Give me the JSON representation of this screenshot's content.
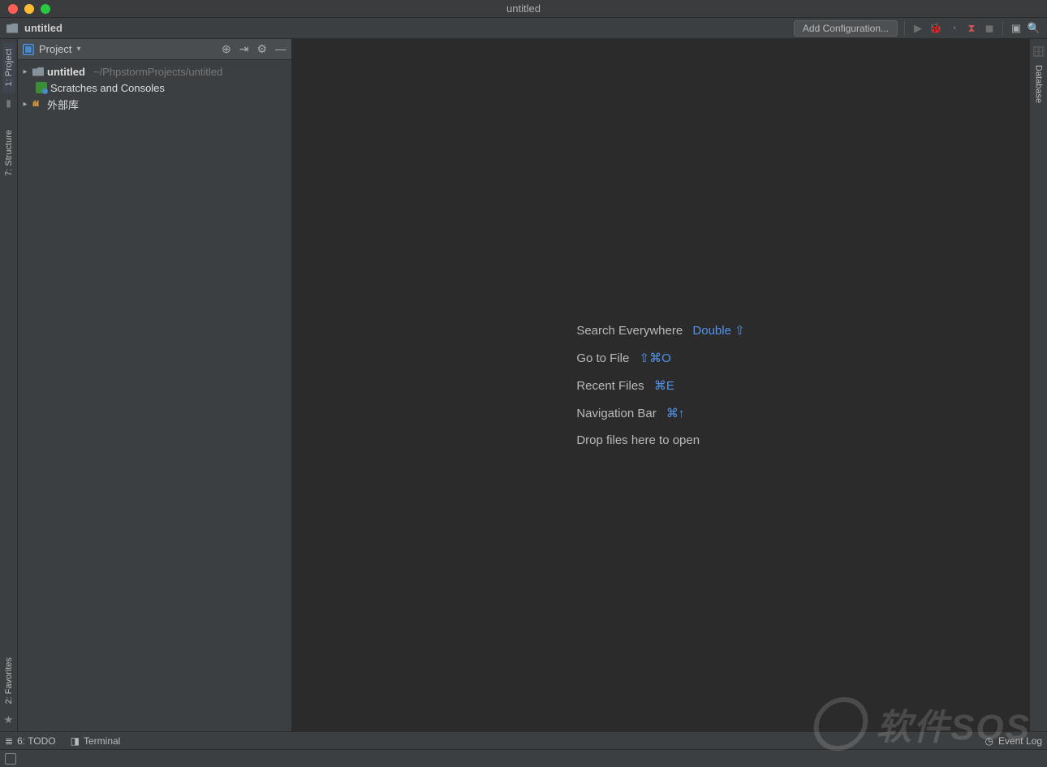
{
  "titlebar": {
    "title": "untitled"
  },
  "navbar": {
    "project_name": "untitled",
    "add_config": "Add Configuration..."
  },
  "left_gutter": {
    "project_tab": "1: Project",
    "structure_tab": "7: Structure",
    "favorites_tab": "2: Favorites"
  },
  "right_gutter": {
    "database_tab": "Database"
  },
  "tool_window": {
    "title": "Project",
    "tree": {
      "root": {
        "name": "untitled",
        "path": "~/PhpstormProjects/untitled"
      },
      "scratches": "Scratches and Consoles",
      "external_libs": "外部库"
    }
  },
  "welcome": {
    "items": [
      {
        "label": "Search Everywhere",
        "shortcut": "Double ⇧"
      },
      {
        "label": "Go to File",
        "shortcut": "⇧⌘O"
      },
      {
        "label": "Recent Files",
        "shortcut": "⌘E"
      },
      {
        "label": "Navigation Bar",
        "shortcut": "⌘↑"
      },
      {
        "label": "Drop files here to open",
        "shortcut": ""
      }
    ]
  },
  "bottombar": {
    "todo": "6: TODO",
    "terminal": "Terminal",
    "event_log": "Event Log"
  },
  "watermark": "软件SOS"
}
